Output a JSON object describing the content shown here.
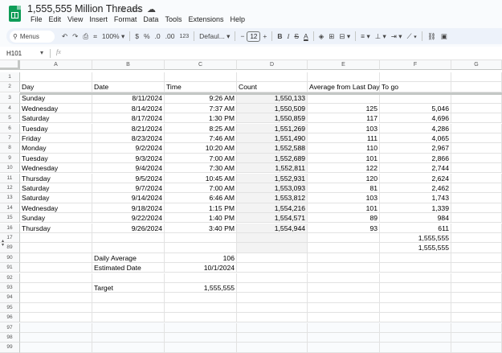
{
  "doc": {
    "title": "1,555,555 Million Threads"
  },
  "menu": [
    "File",
    "Edit",
    "View",
    "Insert",
    "Format",
    "Data",
    "Tools",
    "Extensions",
    "Help"
  ],
  "toolbar": {
    "search_label": "Menus",
    "zoom": "100%",
    "currency": "$",
    "percent": "%",
    "dec_decrease": ".0",
    "dec_increase": ".00",
    "number_format": "123",
    "font": "Defaul...",
    "font_size": "12",
    "bold": "B",
    "italic": "I",
    "strike": "S",
    "text_color": "A"
  },
  "formula_bar": {
    "name_box": "H101",
    "fx": "fx"
  },
  "columns": [
    "A",
    "B",
    "C",
    "D",
    "E",
    "F",
    "G"
  ],
  "rows": [
    {
      "num": "1",
      "cells": [
        "",
        "",
        "",
        "",
        "",
        ""
      ]
    },
    {
      "num": "2",
      "cells": [
        "Day",
        "Date",
        "Time",
        "Count",
        "Average from Last Day",
        "To go"
      ]
    },
    {
      "num": "3",
      "cells": [
        "Sunday",
        "8/11/2024",
        "9:26 AM",
        "1,550,133",
        "",
        ""
      ]
    },
    {
      "num": "4",
      "cells": [
        "Wednesday",
        "8/14/2024",
        "7:37 AM",
        "1,550,509",
        "125",
        "5,046"
      ]
    },
    {
      "num": "5",
      "cells": [
        "Saturday",
        "8/17/2024",
        "1:30 PM",
        "1,550,859",
        "117",
        "4,696"
      ]
    },
    {
      "num": "6",
      "cells": [
        "Tuesday",
        "8/21/2024",
        "8:25 AM",
        "1,551,269",
        "103",
        "4,286"
      ]
    },
    {
      "num": "7",
      "cells": [
        "Friday",
        "8/23/2024",
        "7:46 AM",
        "1,551,490",
        "111",
        "4,065"
      ]
    },
    {
      "num": "8",
      "cells": [
        "Monday",
        "9/2/2024",
        "10:20 AM",
        "1,552,588",
        "110",
        "2,967"
      ]
    },
    {
      "num": "9",
      "cells": [
        "Tuesday",
        "9/3/2024",
        "7:00 AM",
        "1,552,689",
        "101",
        "2,866"
      ]
    },
    {
      "num": "10",
      "cells": [
        "Wednesday",
        "9/4/2024",
        "7:30 AM",
        "1,552,811",
        "122",
        "2,744"
      ]
    },
    {
      "num": "11",
      "cells": [
        "Thursday",
        "9/5/2024",
        "10:45 AM",
        "1,552,931",
        "120",
        "2,624"
      ]
    },
    {
      "num": "12",
      "cells": [
        "Saturday",
        "9/7/2024",
        "7:00 AM",
        "1,553,093",
        "81",
        "2,462"
      ]
    },
    {
      "num": "13",
      "cells": [
        "Saturday",
        "9/14/2024",
        "6:46 AM",
        "1,553,812",
        "103",
        "1,743"
      ]
    },
    {
      "num": "14",
      "cells": [
        "Wednesday",
        "9/18/2024",
        "1:15 PM",
        "1,554,216",
        "101",
        "1,339"
      ]
    },
    {
      "num": "15",
      "cells": [
        "Sunday",
        "9/22/2024",
        "1:40 PM",
        "1,554,571",
        "89",
        "984"
      ]
    },
    {
      "num": "16",
      "cells": [
        "Thursday",
        "9/26/2024",
        "3:40 PM",
        "1,554,944",
        "93",
        "611"
      ]
    },
    {
      "num": "17",
      "cells": [
        "",
        "",
        "",
        "",
        "",
        "1,555,555"
      ]
    },
    {
      "num": "89",
      "cells": [
        "",
        "",
        "",
        "",
        "",
        "1,555,555"
      ]
    },
    {
      "num": "90",
      "cells": [
        "",
        "Daily Average",
        "106",
        "",
        "",
        ""
      ]
    },
    {
      "num": "91",
      "cells": [
        "",
        "Estimated Date",
        "10/1/2024",
        "",
        "",
        ""
      ]
    },
    {
      "num": "92",
      "cells": [
        "",
        "",
        "",
        "",
        "",
        ""
      ]
    },
    {
      "num": "93",
      "cells": [
        "",
        "Target",
        "1,555,555",
        "",
        "",
        ""
      ]
    },
    {
      "num": "94",
      "cells": [
        "",
        "",
        "",
        "",
        "",
        ""
      ]
    },
    {
      "num": "95",
      "cells": [
        "",
        "",
        "",
        "",
        "",
        ""
      ]
    },
    {
      "num": "96",
      "cells": [
        "",
        "",
        "",
        "",
        "",
        ""
      ]
    },
    {
      "num": "97",
      "cells": [
        "",
        "",
        "",
        "",
        "",
        ""
      ]
    },
    {
      "num": "98",
      "cells": [
        "",
        "",
        "",
        "",
        "",
        ""
      ]
    },
    {
      "num": "99",
      "cells": [
        "",
        "",
        "",
        "",
        "",
        ""
      ]
    }
  ]
}
